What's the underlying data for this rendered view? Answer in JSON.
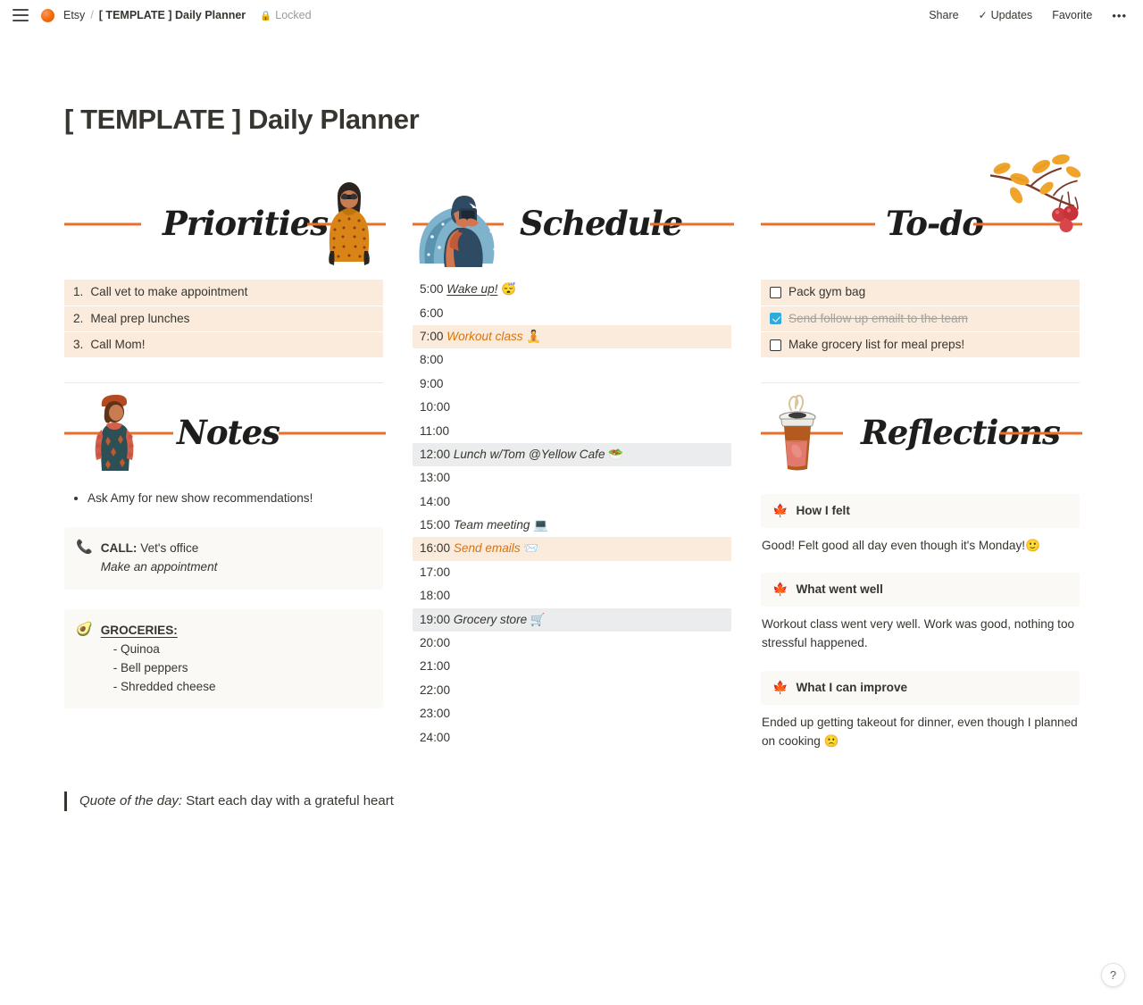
{
  "topbar": {
    "menu_icon": "hamburger-icon",
    "workspace": "Etsy",
    "separator": "/",
    "breadcrumb_page": "[ TEMPLATE ] Daily Planner",
    "lock_icon": "lock-icon",
    "locked_label": "Locked",
    "share_label": "Share",
    "updates_icon": "check-icon",
    "updates_label": "Updates",
    "favorite_label": "Favorite",
    "more_label": "•••"
  },
  "page": {
    "title": "[ TEMPLATE ] Daily Planner"
  },
  "sections": {
    "priorities": {
      "heading": "Priorities",
      "art_icon": "woman-orange-coat-illustration",
      "items": [
        {
          "index": "1.",
          "text": "Call vet to make appointment"
        },
        {
          "index": "2.",
          "text": "Meal prep lunches"
        },
        {
          "index": "3.",
          "text": "Call Mom!"
        }
      ]
    },
    "notes": {
      "heading": "Notes",
      "art_icon": "woman-beret-dress-illustration",
      "bullets": [
        "Ask Amy for new show recommendations!"
      ],
      "call_callout": {
        "emoji": "📞",
        "emoji_name": "telephone-icon",
        "label": "CALL:",
        "value": "Vet's office",
        "subtext": "Make an appointment"
      },
      "groceries_callout": {
        "emoji": "🥑",
        "emoji_name": "avocado-icon",
        "title": "GROCERIES:",
        "items": [
          "- Quinoa",
          "- Bell peppers",
          "- Shredded cheese"
        ]
      }
    },
    "schedule": {
      "heading": "Schedule",
      "art_icon": "woman-blue-hair-phone-illustration",
      "rows": [
        {
          "time": "5:00",
          "text": "Wake up!",
          "emoji": "😴",
          "style": "italic-underline",
          "bg": "none"
        },
        {
          "time": "6:00",
          "text": "",
          "emoji": "",
          "style": "plain",
          "bg": "none"
        },
        {
          "time": "7:00",
          "text": "Workout class",
          "emoji": "🧘",
          "style": "orange-italic",
          "bg": "peach"
        },
        {
          "time": "8:00",
          "text": "",
          "emoji": "",
          "style": "plain",
          "bg": "none"
        },
        {
          "time": "9:00",
          "text": "",
          "emoji": "",
          "style": "plain",
          "bg": "none"
        },
        {
          "time": "10:00",
          "text": "",
          "emoji": "",
          "style": "plain",
          "bg": "none"
        },
        {
          "time": "11:00",
          "text": "",
          "emoji": "",
          "style": "plain",
          "bg": "none"
        },
        {
          "time": "12:00",
          "text": "Lunch w/Tom @Yellow Cafe",
          "emoji": "🥗",
          "style": "italic",
          "bg": "gray"
        },
        {
          "time": "13:00",
          "text": "",
          "emoji": "",
          "style": "plain",
          "bg": "none"
        },
        {
          "time": "14:00",
          "text": "",
          "emoji": "",
          "style": "plain",
          "bg": "none"
        },
        {
          "time": "15:00",
          "text": "Team meeting",
          "emoji": "💻",
          "style": "italic",
          "bg": "none"
        },
        {
          "time": "16:00",
          "text": "Send emails",
          "emoji": "📨",
          "style": "orange-italic",
          "bg": "peach"
        },
        {
          "time": "17:00",
          "text": "",
          "emoji": "",
          "style": "plain",
          "bg": "none"
        },
        {
          "time": "18:00",
          "text": "",
          "emoji": "",
          "style": "plain",
          "bg": "none"
        },
        {
          "time": "19:00",
          "text": "Grocery store",
          "emoji": "🛒",
          "style": "italic",
          "bg": "gray"
        },
        {
          "time": "20:00",
          "text": "",
          "emoji": "",
          "style": "plain",
          "bg": "none"
        },
        {
          "time": "21:00",
          "text": "",
          "emoji": "",
          "style": "plain",
          "bg": "none"
        },
        {
          "time": "22:00",
          "text": "",
          "emoji": "",
          "style": "plain",
          "bg": "none"
        },
        {
          "time": "23:00",
          "text": "",
          "emoji": "",
          "style": "plain",
          "bg": "none"
        },
        {
          "time": "24:00",
          "text": "",
          "emoji": "",
          "style": "plain",
          "bg": "none"
        }
      ]
    },
    "todo": {
      "heading": "To-do",
      "art_icon": "autumn-branch-berries-illustration",
      "items": [
        {
          "text": "Pack gym bag",
          "checked": false
        },
        {
          "text": "Send follow up emailt to the team",
          "checked": true
        },
        {
          "text": "Make grocery list for meal preps!",
          "checked": false
        }
      ]
    },
    "reflections": {
      "heading": "Reflections",
      "art_icon": "coffee-cup-illustration",
      "entries": [
        {
          "emoji": "🍁",
          "emoji_name": "maple-leaf-icon",
          "title": "How I felt",
          "text": "Good! Felt good all day even though it's Monday!🙂"
        },
        {
          "emoji": "🍁",
          "emoji_name": "maple-leaf-icon",
          "title": "What went well",
          "text": "Workout class went very well. Work was good, nothing too stressful happened."
        },
        {
          "emoji": "🍁",
          "emoji_name": "maple-leaf-icon",
          "title": "What I can improve",
          "text": "Ended up getting takeout for dinner, even though I planned on cooking 🙁"
        }
      ]
    }
  },
  "quote": {
    "label": "Quote of the day:",
    "text": " Start each day with a grateful heart"
  },
  "help": {
    "label": "?"
  },
  "colors": {
    "accent_orange": "#e8702a",
    "text_orange": "#d9730d",
    "peach_bg": "#faebdd",
    "gray_bg": "#ebeced",
    "cream_bg": "#fbf9f5",
    "checkbox_blue": "#2eaadc",
    "text": "#37352f"
  }
}
